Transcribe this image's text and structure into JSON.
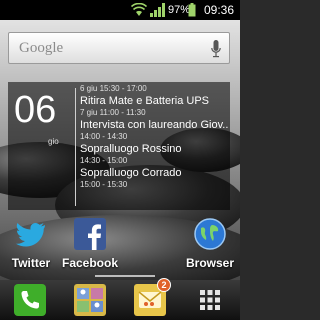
{
  "status_bar": {
    "battery": "97%",
    "time": "09:36"
  },
  "search": {
    "logo": "Google"
  },
  "calendar": {
    "day": "06",
    "weekday": "gio",
    "events": [
      {
        "when": "6 giu   15:30 - 17:00",
        "title": "Ritira Mate e Batteria UPS"
      },
      {
        "when": "7 giu   11:00 - 11:30",
        "title": "Intervista con laureando Giov..."
      },
      {
        "when": "14:00 - 14:30",
        "title": "Sopralluogo Rossino"
      },
      {
        "when": "14:30 - 15:00",
        "title": "Sopralluogo Corrado"
      },
      {
        "when": "15:00 - 15:30",
        "title": ""
      }
    ]
  },
  "apps": [
    {
      "label": "Twitter",
      "icon": "twitter-icon"
    },
    {
      "label": "Facebook",
      "icon": "facebook-icon"
    },
    {
      "label": "Browser",
      "icon": "globe-icon"
    }
  ],
  "dock": {
    "badge_count": "2",
    "items": [
      "phone-icon",
      "contacts-icon",
      "messaging-icon",
      "app-drawer-icon"
    ]
  },
  "colors": {
    "twitter": "#2aa9e0",
    "facebook": "#3b5998",
    "phone": "#3fae2a",
    "badge": "#e0622a"
  }
}
